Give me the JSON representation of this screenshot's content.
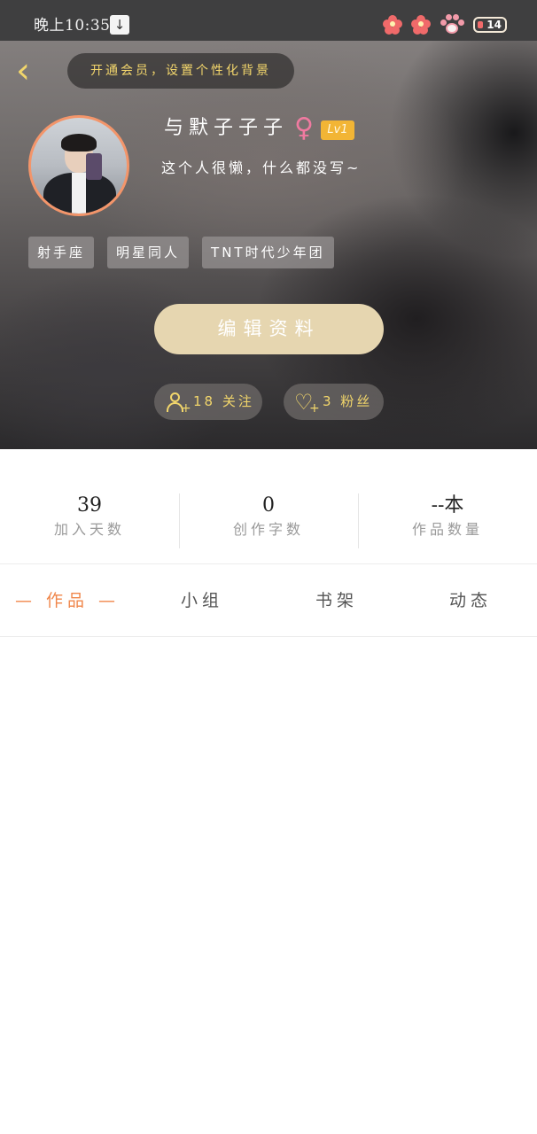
{
  "status_bar": {
    "time": "晚上10:35",
    "download_icon": "download-arrow-icon",
    "battery": "14"
  },
  "header": {
    "back_icon": "chevron-left-icon",
    "vip_banner": "开通会员，设置个性化背景"
  },
  "profile": {
    "nickname": "与默子子子",
    "gender_symbol": "♀",
    "level": "Lv1",
    "bio": "这个人很懒，什么都没写~",
    "tags": [
      "射手座",
      "明星同人",
      "TNT时代少年团"
    ],
    "edit_button": "编辑资料",
    "following": "18 关注",
    "fans": "3 粉丝"
  },
  "stats": [
    {
      "value": "39",
      "label": "加入天数"
    },
    {
      "value": "0",
      "label": "创作字数"
    },
    {
      "value": "--本",
      "label": "作品数量"
    }
  ],
  "tabs": [
    {
      "label": "— 作品 —",
      "active": true
    },
    {
      "label": "小组",
      "active": false
    },
    {
      "label": "书架",
      "active": false
    },
    {
      "label": "动态",
      "active": false
    }
  ],
  "colors": {
    "accent_orange": "#f0864a",
    "gold": "#f2d66b",
    "edit_button_bg": "#e6d6b0",
    "level_badge": "#f2b535",
    "avatar_border": "#f3956a"
  }
}
